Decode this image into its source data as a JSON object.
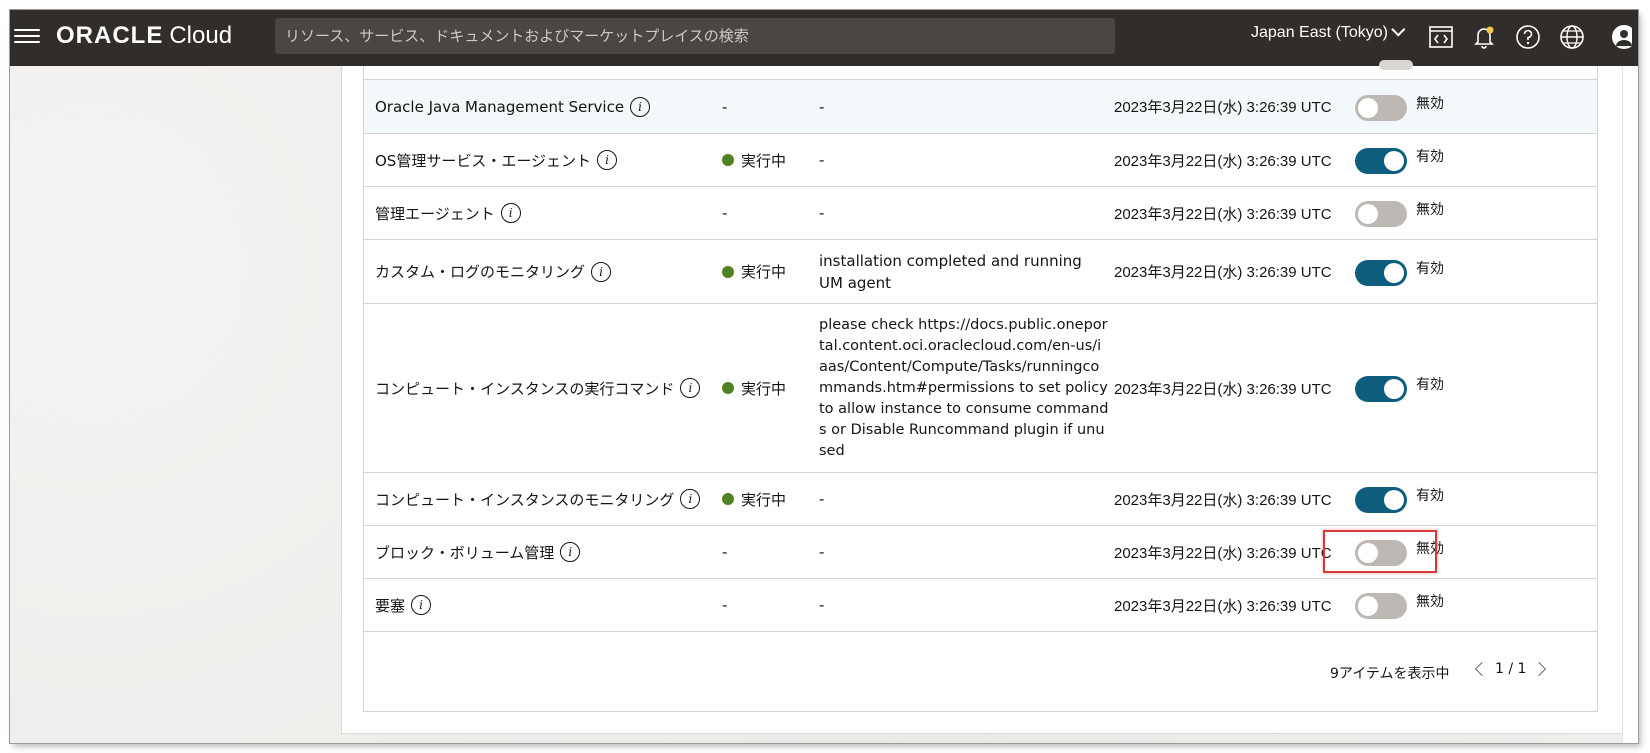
{
  "header": {
    "brand": "ORACLE",
    "product": "Cloud",
    "search_placeholder": "リソース、サービス、ドキュメントおよびマーケットプレイスの検索",
    "region": "Japan East (Tokyo)",
    "icons": [
      "menu-icon",
      "code-editor-icon",
      "bell-icon",
      "help-icon",
      "globe-icon",
      "profile-icon"
    ],
    "colors": {
      "bar": "#312d2a",
      "search": "#4a4643",
      "notification_dot": "#f2c94c"
    }
  },
  "plugins": {
    "rows": [
      {
        "name": "Oracle Java Management Service",
        "status": "-",
        "message": "-",
        "updated": "2023年3月22日(水) 3:26:39 UTC",
        "enabled": false,
        "toggle_label": "無効"
      },
      {
        "name": "OS管理サービス・エージェント",
        "status": "実行中",
        "message": "-",
        "updated": "2023年3月22日(水) 3:26:39 UTC",
        "enabled": true,
        "toggle_label": "有効"
      },
      {
        "name": "管理エージェント",
        "status": "-",
        "message": "-",
        "updated": "2023年3月22日(水) 3:26:39 UTC",
        "enabled": false,
        "toggle_label": "無効"
      },
      {
        "name": "カスタム・ログのモニタリング",
        "status": "実行中",
        "message": "installation completed and running UM agent",
        "updated": "2023年3月22日(水) 3:26:39 UTC",
        "enabled": true,
        "toggle_label": "有効"
      },
      {
        "name": "コンピュート・インスタンスの実行コマンド",
        "status": "実行中",
        "message": "please check https://docs.public.oneportal.content.oci.oraclecloud.com/en-us/iaas/Content/Compute/Tasks/runningcommands.htm#permissions to set policy to allow instance to consume commands or Disable Runcommand plugin if unused",
        "updated": "2023年3月22日(水) 3:26:39 UTC",
        "enabled": true,
        "toggle_label": "有効"
      },
      {
        "name": "コンピュート・インスタンスのモニタリング",
        "status": "実行中",
        "message": "-",
        "updated": "2023年3月22日(水) 3:26:39 UTC",
        "enabled": true,
        "toggle_label": "有効"
      },
      {
        "name": "ブロック・ボリューム管理",
        "status": "-",
        "message": "-",
        "updated": "2023年3月22日(水) 3:26:39 UTC",
        "enabled": false,
        "toggle_label": "無効"
      },
      {
        "name": "要塞",
        "status": "-",
        "message": "-",
        "updated": "2023年3月22日(水) 3:26:39 UTC",
        "enabled": false,
        "toggle_label": "無効"
      }
    ],
    "footer": {
      "count": "9アイテムを表示中",
      "page": "1 / 1"
    },
    "colors": {
      "running_dot": "#508223",
      "toggle_on": "#0f5d7d",
      "toggle_off": "#bdb8b3",
      "highlight": "#d63a3a"
    }
  }
}
